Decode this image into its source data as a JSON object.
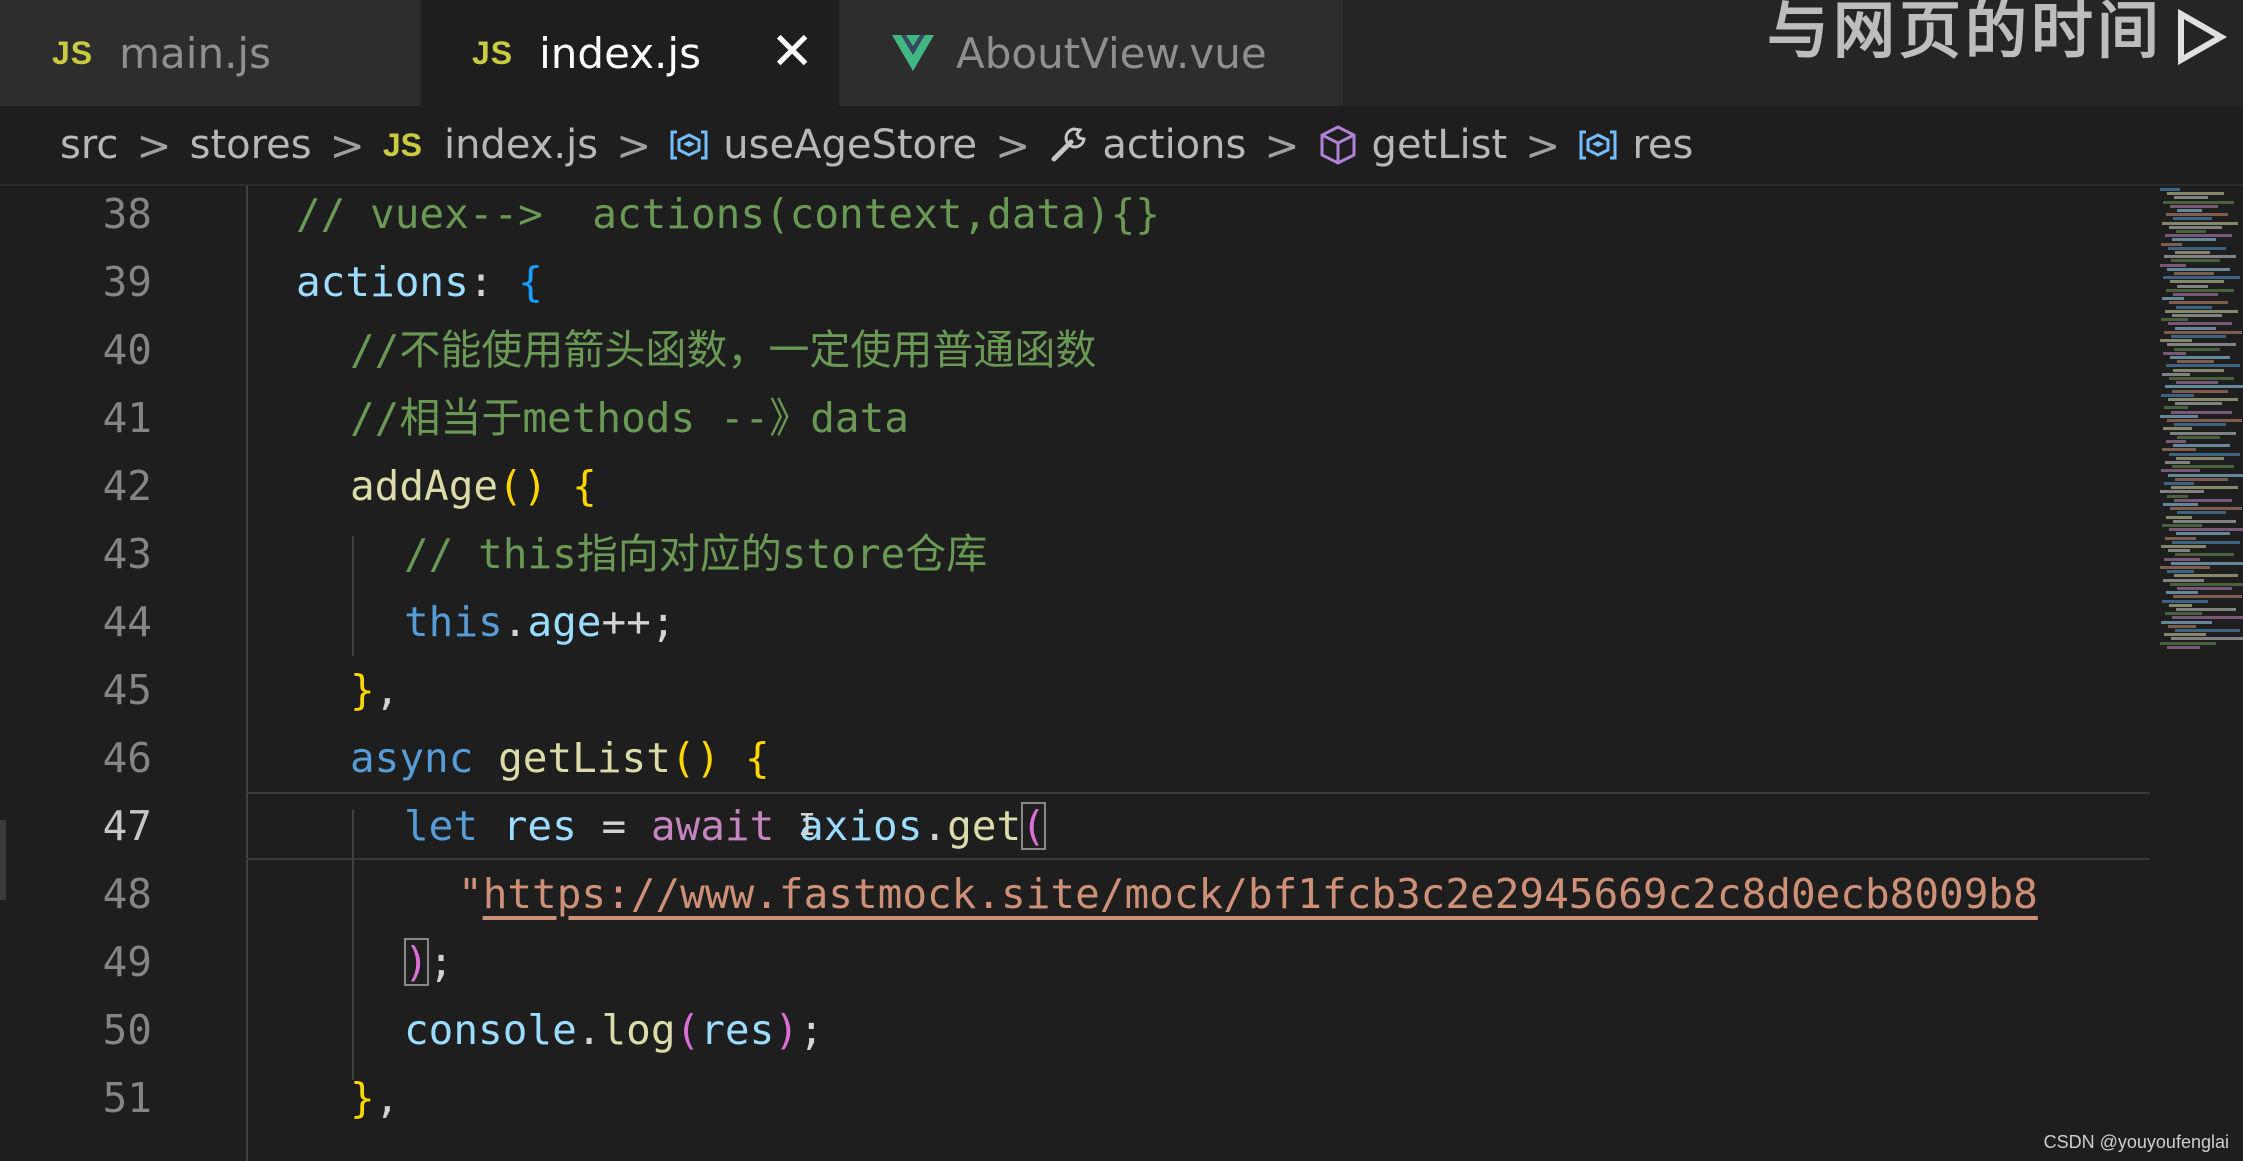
{
  "tabs": [
    {
      "lang": "JS",
      "label": "main.js",
      "active": false
    },
    {
      "lang": "JS",
      "label": "index.js",
      "active": true,
      "close": "✕"
    },
    {
      "lang": "vue",
      "label": "AboutView.vue",
      "active": false
    }
  ],
  "overlay_text": "与网页的时间",
  "breadcrumb": {
    "separator": ">",
    "items": [
      {
        "label": "src",
        "icon": ""
      },
      {
        "label": "stores",
        "icon": ""
      },
      {
        "label": "index.js",
        "icon": "js-badge",
        "badge": "JS"
      },
      {
        "label": "useAgeStore",
        "icon": "variable-icon"
      },
      {
        "label": "actions",
        "icon": "wrench-icon"
      },
      {
        "label": "getList",
        "icon": "method-cube-icon"
      },
      {
        "label": "res",
        "icon": "variable-icon"
      }
    ]
  },
  "editor": {
    "current_line": "47",
    "lines": [
      {
        "n": "38",
        "tokens": [
          [
            "c-comment",
            "// vuex-->  actions(context,data){}"
          ]
        ]
      },
      {
        "n": "39",
        "tokens": [
          [
            "c-prop",
            "actions"
          ],
          [
            "c-punc",
            ": "
          ],
          [
            "b3",
            "{"
          ]
        ]
      },
      {
        "n": "40",
        "tokens": [
          [
            "c-comment",
            "//不能使用箭头函数，一定使用普通函数"
          ]
        ]
      },
      {
        "n": "41",
        "tokens": [
          [
            "c-comment",
            "//相当于methods --》data"
          ]
        ]
      },
      {
        "n": "42",
        "tokens": [
          [
            "c-fn",
            "addAge"
          ],
          [
            "b1",
            "()"
          ],
          [
            "c-punc",
            " "
          ],
          [
            "b1",
            "{"
          ]
        ]
      },
      {
        "n": "43",
        "tokens": [
          [
            "c-comment",
            "// this指向对应的store仓库"
          ]
        ]
      },
      {
        "n": "44",
        "tokens": [
          [
            "c-kw",
            "this"
          ],
          [
            "c-punc",
            "."
          ],
          [
            "c-prop",
            "age"
          ],
          [
            "c-punc",
            "++;"
          ]
        ]
      },
      {
        "n": "45",
        "tokens": [
          [
            "b1",
            "}"
          ],
          [
            "c-punc",
            ","
          ]
        ]
      },
      {
        "n": "46",
        "tokens": [
          [
            "c-kw",
            "async"
          ],
          [
            "c-punc",
            " "
          ],
          [
            "c-fn",
            "getList"
          ],
          [
            "b1",
            "()"
          ],
          [
            "c-punc",
            " "
          ],
          [
            "b1",
            "{"
          ]
        ]
      },
      {
        "n": "47",
        "tokens": [
          [
            "c-kw",
            "let"
          ],
          [
            "c-punc",
            " "
          ],
          [
            "c-prop",
            "res"
          ],
          [
            "c-punc",
            " = "
          ],
          [
            "c-ctrl",
            "await"
          ],
          [
            "c-punc",
            " "
          ],
          [
            "c-prop",
            "axios"
          ],
          [
            "c-punc",
            "."
          ],
          [
            "c-fn",
            "get"
          ],
          [
            "b2",
            "("
          ]
        ]
      },
      {
        "n": "48",
        "tokens": [
          [
            "c-str",
            "\""
          ],
          [
            "c-url",
            "https://www.fastmock.site/mock/bf1fcb3c2e2945669c2c8d0ecb8009b8"
          ]
        ]
      },
      {
        "n": "49",
        "tokens": [
          [
            "b2",
            ")"
          ],
          [
            "c-punc",
            ";"
          ]
        ]
      },
      {
        "n": "50",
        "tokens": [
          [
            "c-prop",
            "console"
          ],
          [
            "c-punc",
            "."
          ],
          [
            "c-fn",
            "log"
          ],
          [
            "b2",
            "("
          ],
          [
            "c-prop",
            "res"
          ],
          [
            "b2",
            ")"
          ],
          [
            "c-punc",
            ";"
          ]
        ]
      },
      {
        "n": "51",
        "tokens": [
          [
            "b1",
            "}"
          ],
          [
            "c-punc",
            ","
          ]
        ]
      }
    ]
  },
  "colors": {
    "background": "#1e1e1e",
    "tabbar": "#252526",
    "comment": "#6a9955",
    "keyword": "#569cd6",
    "function": "#dcdcaa",
    "property": "#9cdcfe",
    "string": "#ce9178",
    "control": "#c586c0",
    "vue_green": "#41b883"
  },
  "watermark": "CSDN @youyoufenglai"
}
